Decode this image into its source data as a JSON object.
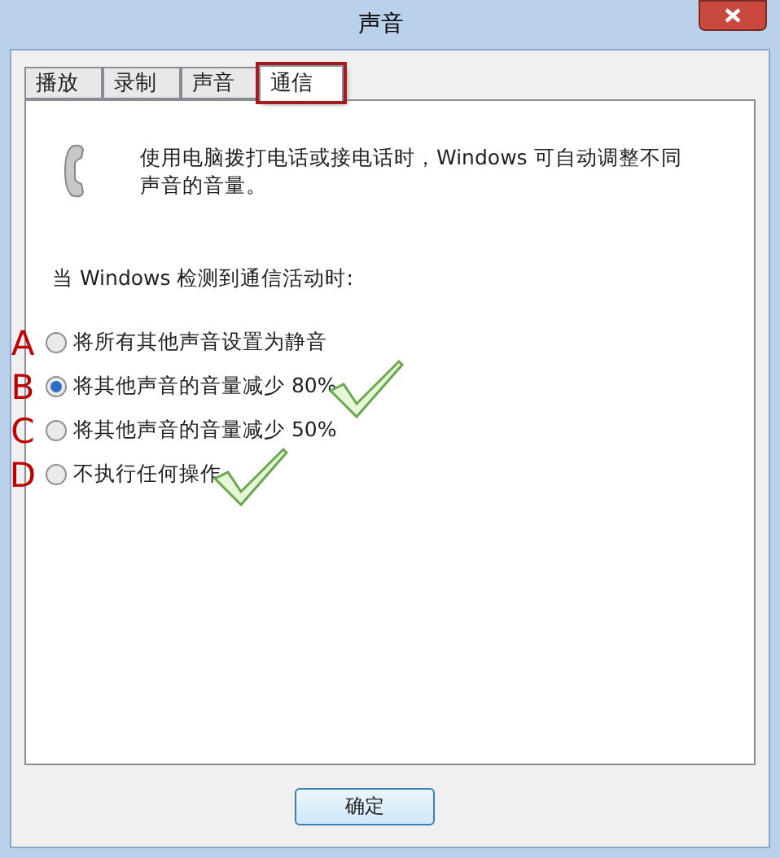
{
  "window": {
    "title": "声音"
  },
  "tabs": [
    {
      "label": "播放",
      "selected": false,
      "highlighted": false
    },
    {
      "label": "录制",
      "selected": false,
      "highlighted": false
    },
    {
      "label": "声音",
      "selected": false,
      "highlighted": false
    },
    {
      "label": "通信",
      "selected": true,
      "highlighted": true
    }
  ],
  "description": "使用电脑拨打电话或接电话时，Windows 可自动调整不同声音的音量。",
  "heading": "当 Windows 检测到通信活动时:",
  "options": [
    {
      "marker": "A",
      "label": "将所有其他声音设置为静音",
      "selected": false,
      "tick": false
    },
    {
      "marker": "B",
      "label": "将其他声音的音量减少 80%",
      "selected": true,
      "tick": true
    },
    {
      "marker": "C",
      "label": "将其他声音的音量减少 50%",
      "selected": false,
      "tick": false
    },
    {
      "marker": "D",
      "label": "不执行任何操作",
      "selected": false,
      "tick": true
    }
  ],
  "buttons": [
    "确定"
  ]
}
